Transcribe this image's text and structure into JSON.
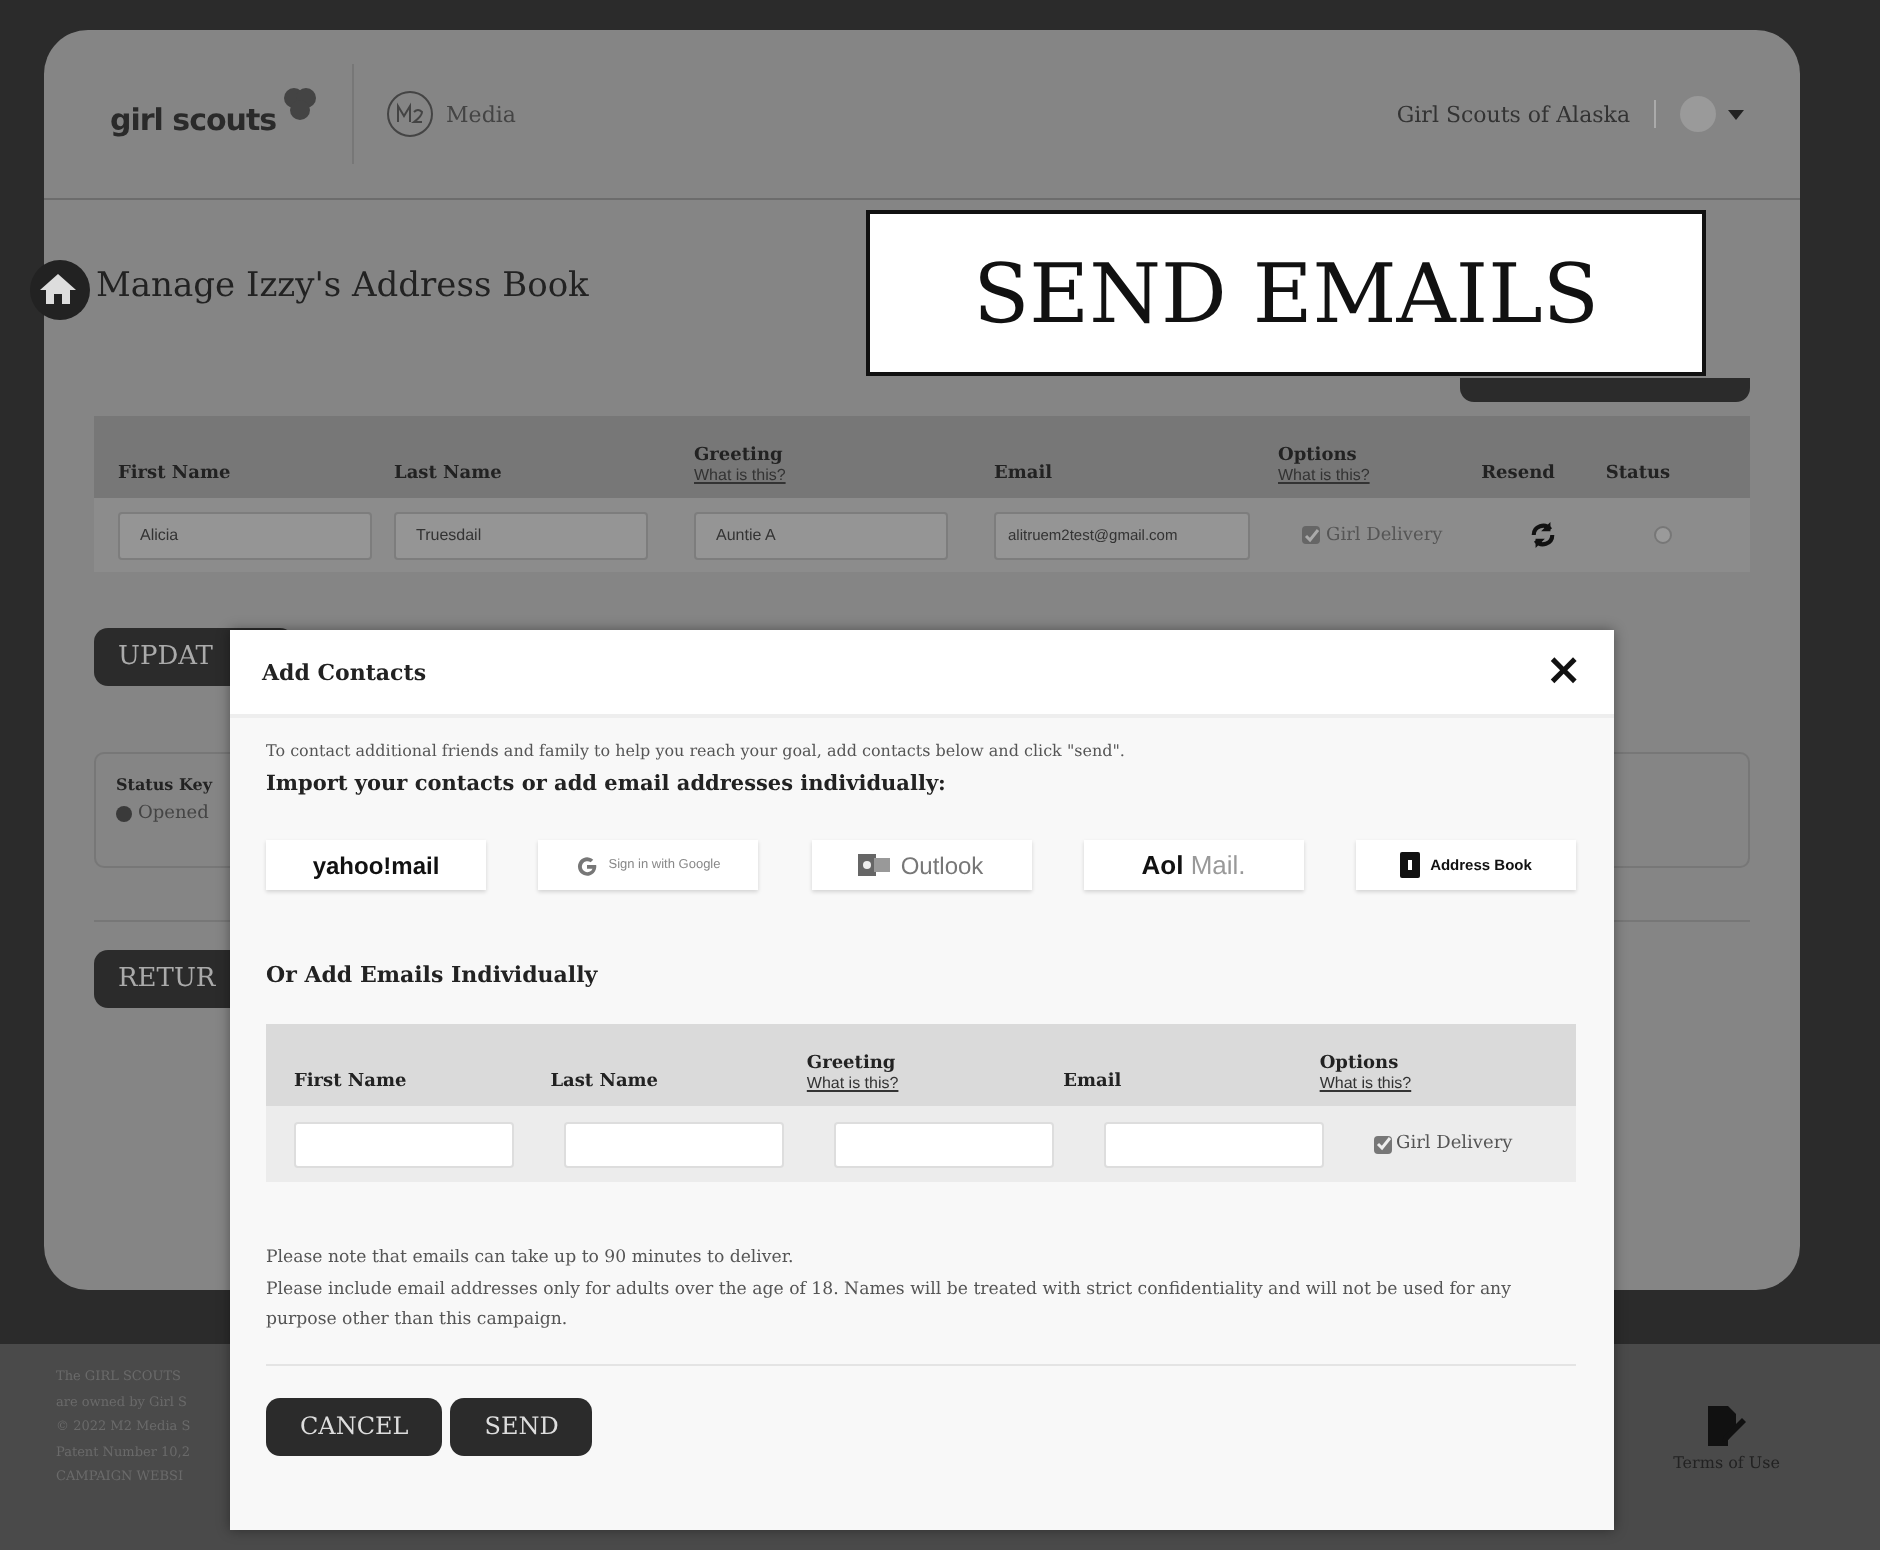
{
  "header": {
    "logo": "girl scouts",
    "brand": "Media",
    "org": "Girl Scouts of Alaska"
  },
  "page": {
    "title": "Manage Izzy's Address Book"
  },
  "table": {
    "columns": [
      {
        "label": "First Name"
      },
      {
        "label": "Last Name"
      },
      {
        "label": "Greeting",
        "link": "What is this?"
      },
      {
        "label": "Email"
      },
      {
        "label": "Options",
        "link": "What is this?"
      },
      {
        "label": "Resend"
      },
      {
        "label": "Status"
      }
    ],
    "rows": [
      {
        "first_name": "Alicia",
        "last_name": "Truesdail",
        "greeting": "Auntie A",
        "email": "alitruem2test@gmail.com",
        "option": "Girl Delivery",
        "checked": true
      }
    ]
  },
  "update_button": "UPDAT",
  "status_key": {
    "title": "Status Key",
    "items": [
      "Opened"
    ]
  },
  "return_button": "RETUR",
  "footer": {
    "lines": [
      "The GIRL SCOUTS",
      "are owned by Girl S",
      "© 2022 M2 Media S",
      "Patent Number 10,2",
      "CAMPAIGN WEBSI"
    ],
    "terms": "Terms of Use"
  },
  "overlay_label": "SEND EMAILS",
  "modal": {
    "title": "Add Contacts",
    "close": "×",
    "intro": "To contact additional friends and family to help you reach your goal, add contacts below and click \"send\".",
    "import_heading": "Import your contacts or add email addresses individually:",
    "providers": [
      {
        "kind": "yahoo",
        "label": "yahoo!mail"
      },
      {
        "kind": "google",
        "label": "Sign in with Google"
      },
      {
        "kind": "outlook",
        "label": "Outlook"
      },
      {
        "kind": "aol",
        "label": "Aol",
        "label2": "Mail."
      },
      {
        "kind": "book",
        "label": "Address Book"
      }
    ],
    "individual_heading": "Or Add Emails Individually",
    "columns": [
      {
        "label": "First Name"
      },
      {
        "label": "Last Name"
      },
      {
        "label": "Greeting",
        "link": "What is this?"
      },
      {
        "label": "Email"
      },
      {
        "label": "Options",
        "link": "What is this?"
      }
    ],
    "option": {
      "label": "Girl Delivery",
      "checked": true
    },
    "notes": [
      "Please note that emails can take up to 90 minutes to deliver.",
      "Please include email addresses only for adults over the age of 18. Names will be treated with strict confidentiality and will not be used for any purpose other than this campaign."
    ],
    "buttons": [
      "CANCEL",
      "SEND"
    ]
  }
}
